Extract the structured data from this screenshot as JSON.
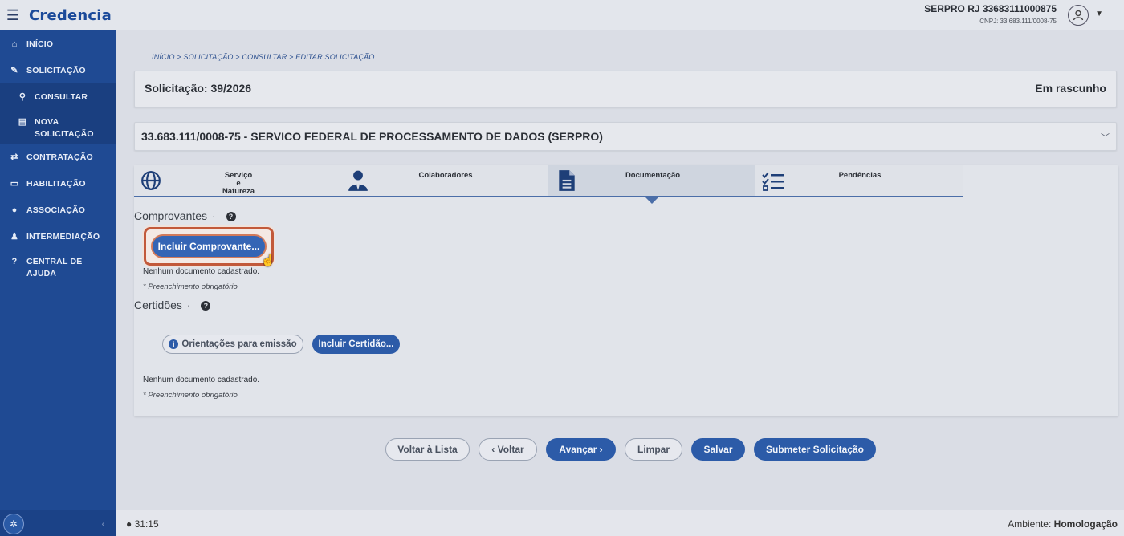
{
  "app": {
    "brand": "Credencia",
    "menu_icon": "hamburger-icon"
  },
  "user": {
    "name": "SERPRO RJ 33683111000875",
    "cnpj": "CNPJ: 33.683.111/0008-75"
  },
  "sidebar": {
    "items": [
      {
        "label": "INÍCIO",
        "icon": "home-icon"
      },
      {
        "label": "SOLICITAÇÃO",
        "icon": "edit-icon"
      },
      {
        "label": "CONSULTAR",
        "icon": "search-icon"
      },
      {
        "label": "NOVA SOLICITAÇÃO",
        "icon": "file-icon"
      },
      {
        "label": "CONTRATAÇÃO",
        "icon": "handshake-icon"
      },
      {
        "label": "HABILITAÇÃO",
        "icon": "id-card-icon"
      },
      {
        "label": "ASSOCIAÇÃO",
        "icon": "users-icon"
      },
      {
        "label": "INTERMEDIAÇÃO",
        "icon": "user-tie-icon"
      },
      {
        "label": "CENTRAL DE AJUDA",
        "icon": "question-icon"
      }
    ]
  },
  "breadcrumb": "INÍCIO  >  SOLICITAÇÃO  >  CONSULTAR  >  EDITAR SOLICITAÇÃO",
  "solicitacao": {
    "title": "Solicitação: 39/2026",
    "status": "Em rascunho"
  },
  "organization": "33.683.111/0008-75 - SERVICO FEDERAL DE PROCESSAMENTO DE DADOS (SERPRO)",
  "tabs": [
    {
      "label": "Serviço\ne\nNatureza",
      "icon": "globe-icon"
    },
    {
      "label": "Colaboradores",
      "icon": "user-icon"
    },
    {
      "label": "Documentação",
      "icon": "document-icon",
      "active": true
    },
    {
      "label": "Pendências",
      "icon": "checklist-icon"
    }
  ],
  "comprovantes": {
    "title": "Comprovantes",
    "dot": "·",
    "button": "Incluir Comprovante...",
    "empty": "Nenhum documento cadastrado.",
    "required": "* Preenchimento obrigatório"
  },
  "certidoes": {
    "title": "Certidões",
    "dot": "·",
    "orient_button": "Orientações para emissão",
    "button": "Incluir Certidão...",
    "empty": "Nenhum documento cadastrado.",
    "required": "* Preenchimento obrigatório"
  },
  "footer_buttons": {
    "voltar_lista": "Voltar à Lista",
    "voltar": "‹ Voltar",
    "avancar": "Avançar ›",
    "limpar": "Limpar",
    "salvar": "Salvar",
    "submeter": "Submeter Solicitação"
  },
  "status": {
    "timer": "31:15",
    "env_label": "Ambiente:",
    "env_value": "Homologação"
  },
  "colors": {
    "sidebar": "#1f4a93",
    "primary": "#2c5ba8",
    "highlight": "#c2593a"
  }
}
